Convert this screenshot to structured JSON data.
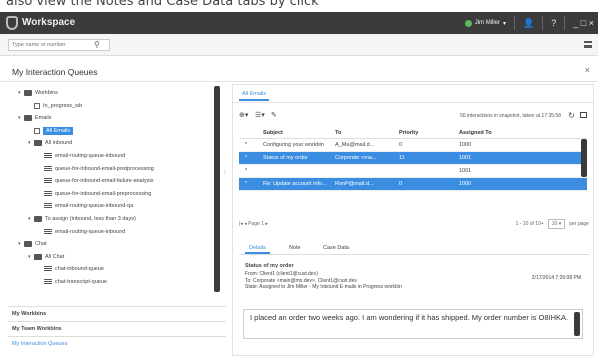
{
  "caption": "also view the Notes and Case Data tabs by click",
  "app": {
    "title": "Workspace",
    "user": "Jim Miller",
    "user_caret": "▾",
    "person_glyph": "👤",
    "help_glyph": "?",
    "window_controls": "_ □ ×"
  },
  "search": {
    "placeholder": "Type name or number"
  },
  "queues": {
    "title": "My Interaction Queues",
    "close": "×",
    "tree": [
      {
        "label": "Workbins",
        "twisty": "▾",
        "icon": "folder",
        "indent": 0
      },
      {
        "label": "In_progress_wb",
        "twisty": "",
        "icon": "queue",
        "indent": 1
      },
      {
        "label": "Emails",
        "twisty": "▾",
        "icon": "folder",
        "indent": 0
      },
      {
        "label": "All Emails",
        "twisty": "",
        "icon": "queue",
        "indent": 1,
        "selected": true
      },
      {
        "label": "All inbound",
        "twisty": "▾",
        "icon": "folder",
        "indent": 1
      },
      {
        "label": "email-routing-queue-inbound",
        "twisty": "",
        "icon": "list",
        "indent": 2
      },
      {
        "label": "queue-for-inbound-email-postprocessing",
        "twisty": "",
        "icon": "list",
        "indent": 2
      },
      {
        "label": "queue-for-inbound-email-failure-analysis",
        "twisty": "",
        "icon": "list",
        "indent": 2
      },
      {
        "label": "queue-for-inbound-email-preprocessing",
        "twisty": "",
        "icon": "list",
        "indent": 2
      },
      {
        "label": "email-routing-queue-inbound-qa",
        "twisty": "",
        "icon": "list",
        "indent": 2
      },
      {
        "label": "To assign (inbound, less than 3 days)",
        "twisty": "▾",
        "icon": "folder",
        "indent": 1
      },
      {
        "label": "email-routing-queue-inbound",
        "twisty": "",
        "icon": "list",
        "indent": 2
      },
      {
        "label": "Chat",
        "twisty": "▾",
        "icon": "folder",
        "indent": 0
      },
      {
        "label": "All Chat",
        "twisty": "▾",
        "icon": "folder",
        "indent": 1
      },
      {
        "label": "chat-inbound-queue",
        "twisty": "",
        "icon": "list",
        "indent": 2
      },
      {
        "label": "chat-transcript-queue",
        "twisty": "",
        "icon": "list",
        "indent": 2
      }
    ],
    "sections": [
      "My Workbins",
      "My Team Workbins",
      "My Interaction Queues"
    ]
  },
  "right": {
    "tab": "All Emails",
    "snapshot_info": "56 interactions in snapshot, taken at 17:35:58",
    "columns": [
      "",
      "Subject",
      "To",
      "Priority",
      "Assigned To"
    ],
    "rows": [
      {
        "mark": "*",
        "subject": "Configuring your workbin",
        "to": "A_Ma@mail.d...",
        "priority": "0",
        "assigned": "1000",
        "selected": false
      },
      {
        "mark": "*",
        "subject": "Status of my order",
        "to": "Corporate <ma...",
        "priority": "11",
        "assigned": "1001",
        "selected": true
      },
      {
        "mark": "*",
        "subject": "",
        "to": "",
        "priority": "",
        "assigned": "1001",
        "selected": false
      },
      {
        "mark": "*",
        "subject": "Re: Update account info...",
        "to": "RonP@mail.d...",
        "priority": "0",
        "assigned": "1000",
        "selected": true
      }
    ],
    "pager": {
      "nav": "|◂ ◂ Page 1 ▸",
      "range": "1 - 10 of 10+",
      "per_page_value": "10",
      "per_page_label": "per page"
    }
  },
  "detail": {
    "tabs": [
      "Details",
      "Note",
      "Case Data"
    ],
    "subject": "Status of my order",
    "from": "From:  Client1 (client1@cust.dev)",
    "to": "To:      Corporate <main@mo.dev>, Client1@cust.dev",
    "state": "State:  Assigned to Jim Miller - My Inbound E-mails in Progress workbin",
    "date": "2/17/2014 7:26:08 PM",
    "message": "I placed an order two weeks ago. I am wondering if it has shipped. My order number is O8IHKA."
  }
}
